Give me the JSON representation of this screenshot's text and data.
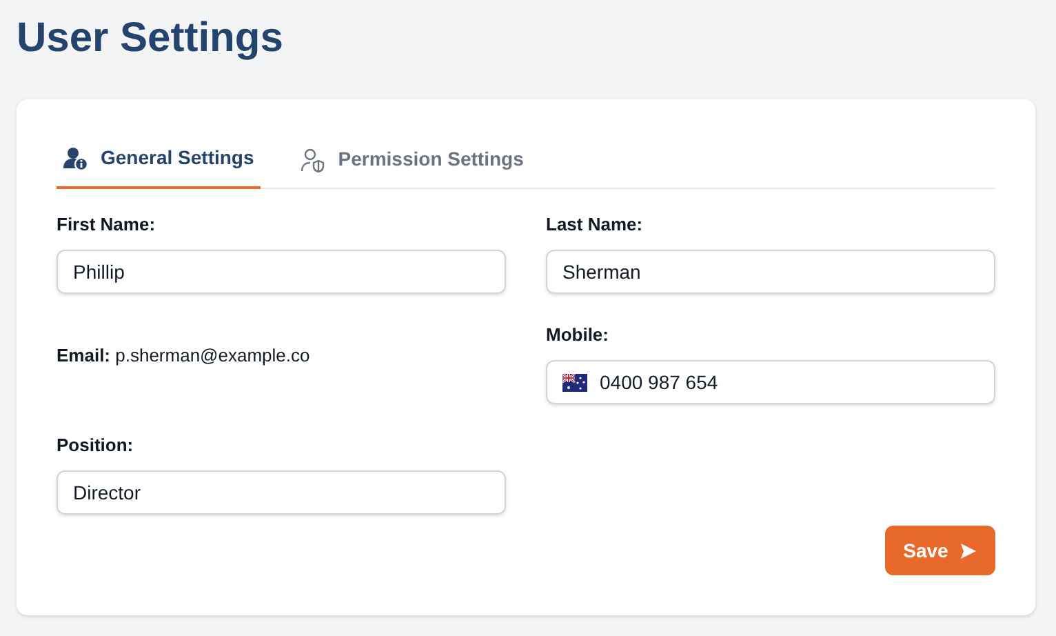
{
  "page_title": "User Settings",
  "tabs": [
    {
      "label": "General Settings",
      "selected": true
    },
    {
      "label": "Permission Settings",
      "selected": false
    }
  ],
  "left_column": [
    {
      "kind": "input",
      "label": "First Name:",
      "value": "Phillip"
    },
    {
      "kind": "text",
      "text": "**Email:** p.sherman@example.co"
    },
    {
      "kind": "input",
      "label": "Position:",
      "value": "Director"
    }
  ],
  "right_column": [
    {
      "kind": "input",
      "label": "Last Name:",
      "value": "Sherman"
    },
    {
      "kind": "phone",
      "label": "Mobile:",
      "value": "0400 987 654"
    }
  ],
  "save_button": {
    "label": "Save"
  }
}
